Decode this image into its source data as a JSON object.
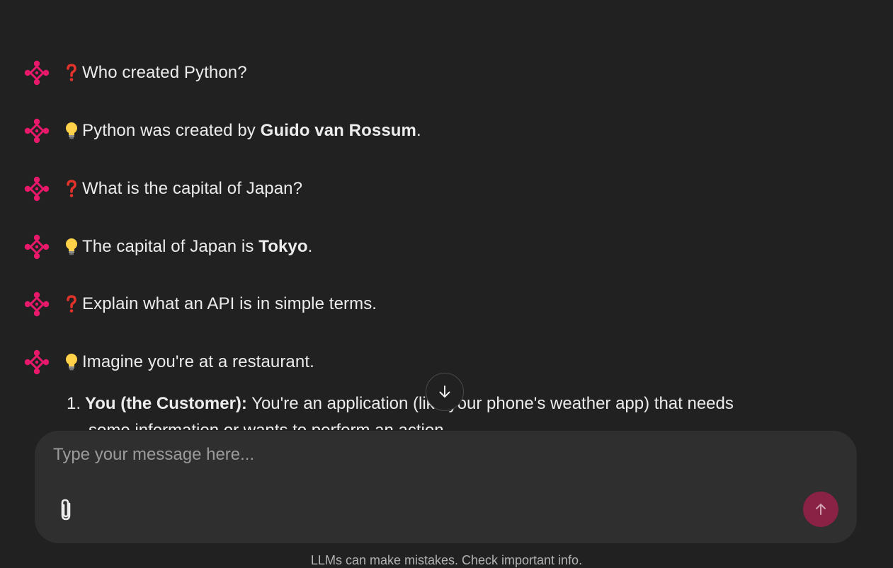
{
  "messages": [
    {
      "role": "question",
      "emoji": "question-mark-icon",
      "text": "Who created Python?"
    },
    {
      "role": "answer",
      "emoji": "lightbulb-icon",
      "pre": "Python was created by ",
      "bold": "Guido van Rossum",
      "post": "."
    },
    {
      "role": "question",
      "emoji": "question-mark-icon",
      "text": "What is the capital of Japan?"
    },
    {
      "role": "answer",
      "emoji": "lightbulb-icon",
      "pre": "The capital of Japan is ",
      "bold": "Tokyo",
      "post": "."
    },
    {
      "role": "question",
      "emoji": "question-mark-icon",
      "text": "Explain what an API is in simple terms."
    },
    {
      "role": "answer",
      "emoji": "lightbulb-icon",
      "text": "Imagine you're at a restaurant."
    }
  ],
  "list": {
    "number": "1.",
    "bold": "You (the Customer):",
    "text": " You're an application (like your phone's weather app) that needs",
    "continuation": "some information or wants to perform an action."
  },
  "composer": {
    "placeholder": "Type your message here..."
  },
  "footer": {
    "note": "LLMs can make mistakes. Check important info."
  },
  "colors": {
    "background": "#212121",
    "composer": "#2f2f2f",
    "accent": "#e8196b",
    "send_button": "#8a2245"
  },
  "icons": {
    "avatar": "flower-logo-icon",
    "scroll": "arrow-down-icon",
    "attach": "paperclip-icon",
    "send": "arrow-up-icon"
  }
}
